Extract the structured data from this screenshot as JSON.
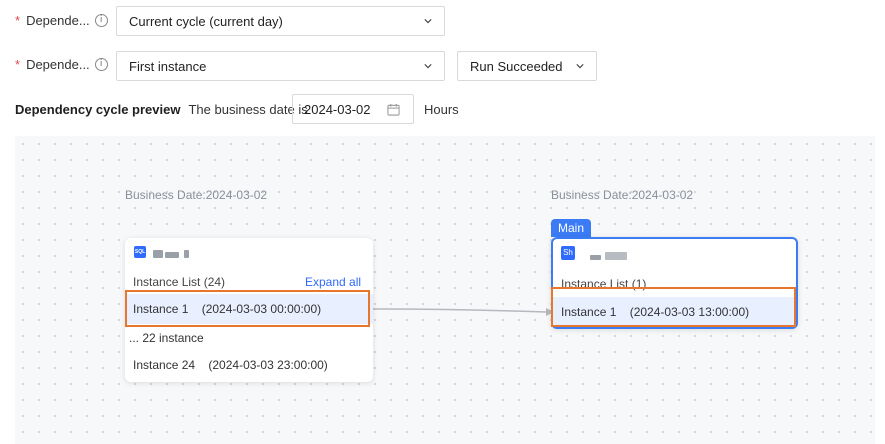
{
  "form": {
    "row1": {
      "label": "Depende...",
      "value": "Current cycle (current day)"
    },
    "row2": {
      "label": "Depende...",
      "value": "First instance",
      "status": "Run Succeeded"
    }
  },
  "preview": {
    "title": "Dependency cycle preview",
    "business_date_label": "The business date is",
    "date_value": "2024-03-02",
    "unit": "Hours"
  },
  "left_node": {
    "business_date": "Business Date:2024-03-02",
    "icon": "SQL",
    "list_title": "Instance List (24)",
    "expand_label": "Expand all",
    "instances": [
      "Instance 1    (2024-03-03 00:00:00)",
      "... 22 instance",
      "Instance 24    (2024-03-03 23:00:00)"
    ]
  },
  "right_node": {
    "business_date": "Business Date:2024-03-02",
    "tag": "Main",
    "icon": "Sh",
    "list_title": "Instance List (1)",
    "instance": "Instance 1    (2024-03-03 13:00:00)"
  },
  "colors": {
    "accent": "#3b7cf6",
    "highlight": "#e8772e",
    "required": "#e5484d"
  }
}
